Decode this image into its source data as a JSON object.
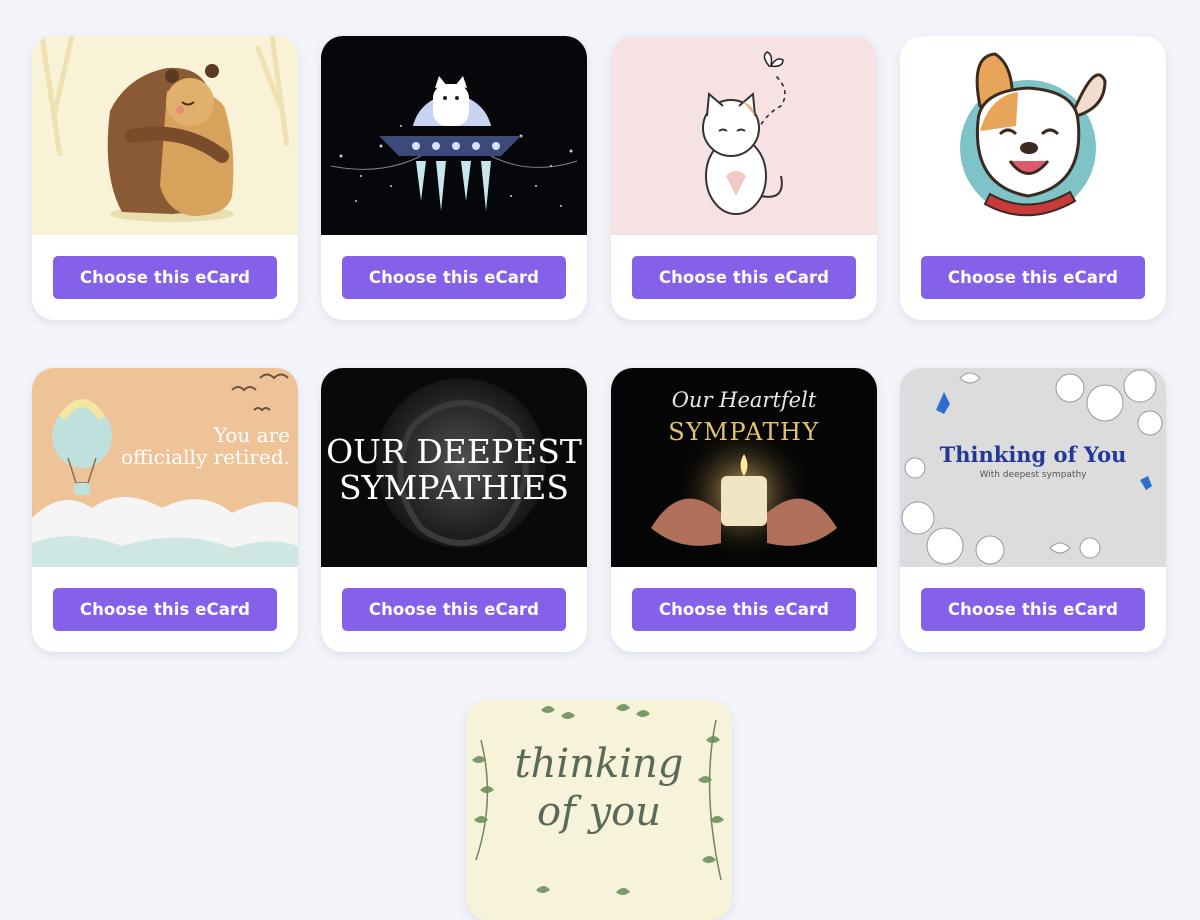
{
  "button_label": "Choose this eCard",
  "accent_color": "#8560e8",
  "cards": [
    {
      "theme": "hugging-bears",
      "art_text": []
    },
    {
      "theme": "cat-in-ufo",
      "art_text": []
    },
    {
      "theme": "cat-with-butterfly",
      "art_text": []
    },
    {
      "theme": "happy-dog",
      "art_text": []
    },
    {
      "theme": "retirement-balloon",
      "art_text": [
        "You are",
        "officially retired."
      ]
    },
    {
      "theme": "dark-rose",
      "art_text": [
        "OUR DEEPEST",
        "SYMPATHIES"
      ]
    },
    {
      "theme": "candle-in-hands",
      "art_text": [
        "Our Heartfelt",
        "SYMPATHY"
      ]
    },
    {
      "theme": "floral-birds",
      "art_text": [
        "Thinking of You",
        "With deepest sympathy"
      ]
    },
    {
      "theme": "leafy-frame",
      "art_text": [
        "thinking",
        "of you"
      ]
    }
  ]
}
